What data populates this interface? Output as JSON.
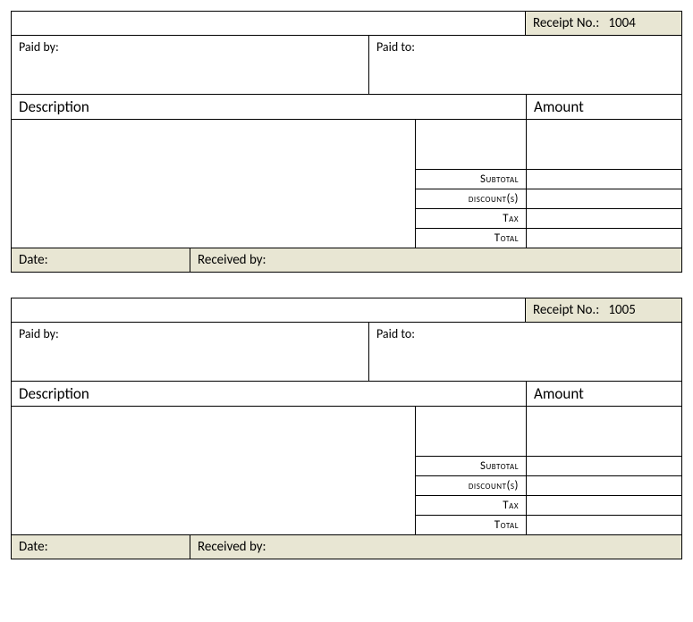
{
  "labels": {
    "receipt_no": "Receipt No.:",
    "paid_by": "Paid by:",
    "paid_to": "Paid to:",
    "description": "Description",
    "amount": "Amount",
    "subtotal": "Subtotal",
    "discounts": "discount(s)",
    "tax": "Tax",
    "total": "Total",
    "date": "Date:",
    "received_by": "Received by:"
  },
  "receipts": [
    {
      "number": "1004",
      "paid_by": "",
      "paid_to": "",
      "description": "",
      "amount": "",
      "subtotal": "",
      "discounts": "",
      "tax": "",
      "total": "",
      "date": "",
      "received_by": ""
    },
    {
      "number": "1005",
      "paid_by": "",
      "paid_to": "",
      "description": "",
      "amount": "",
      "subtotal": "",
      "discounts": "",
      "tax": "",
      "total": "",
      "date": "",
      "received_by": ""
    }
  ]
}
